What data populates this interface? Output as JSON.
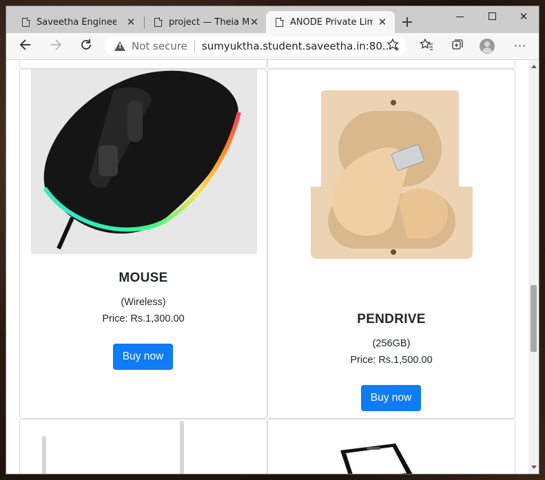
{
  "browser": {
    "tabs": [
      {
        "title": "Saveetha Engineering"
      },
      {
        "title": "project — Theia Multi-"
      },
      {
        "title": "ANODE Private Limited"
      }
    ],
    "address": {
      "security_label": "Not secure",
      "url": "sumyuktha.student.saveetha.in:80..."
    }
  },
  "products": [
    {
      "name": "MOUSE",
      "desc": "(Wireless)",
      "price": "Price: Rs.1,300.00",
      "button": "Buy now"
    },
    {
      "name": "PENDRIVE",
      "desc": "(256GB)",
      "price": "Price: Rs.1,500.00",
      "button": "Buy now"
    }
  ],
  "icons": {
    "back": "arrow-left-icon",
    "forward": "arrow-right-icon",
    "reload": "reload-icon",
    "favorite_add": "star-plus-icon",
    "favorites": "favorites-icon",
    "collections": "collections-icon",
    "profile": "avatar",
    "menu": "more-icon"
  },
  "colors": {
    "accent": "#0d7cf5",
    "tabstrip": "#cdcdcd"
  }
}
